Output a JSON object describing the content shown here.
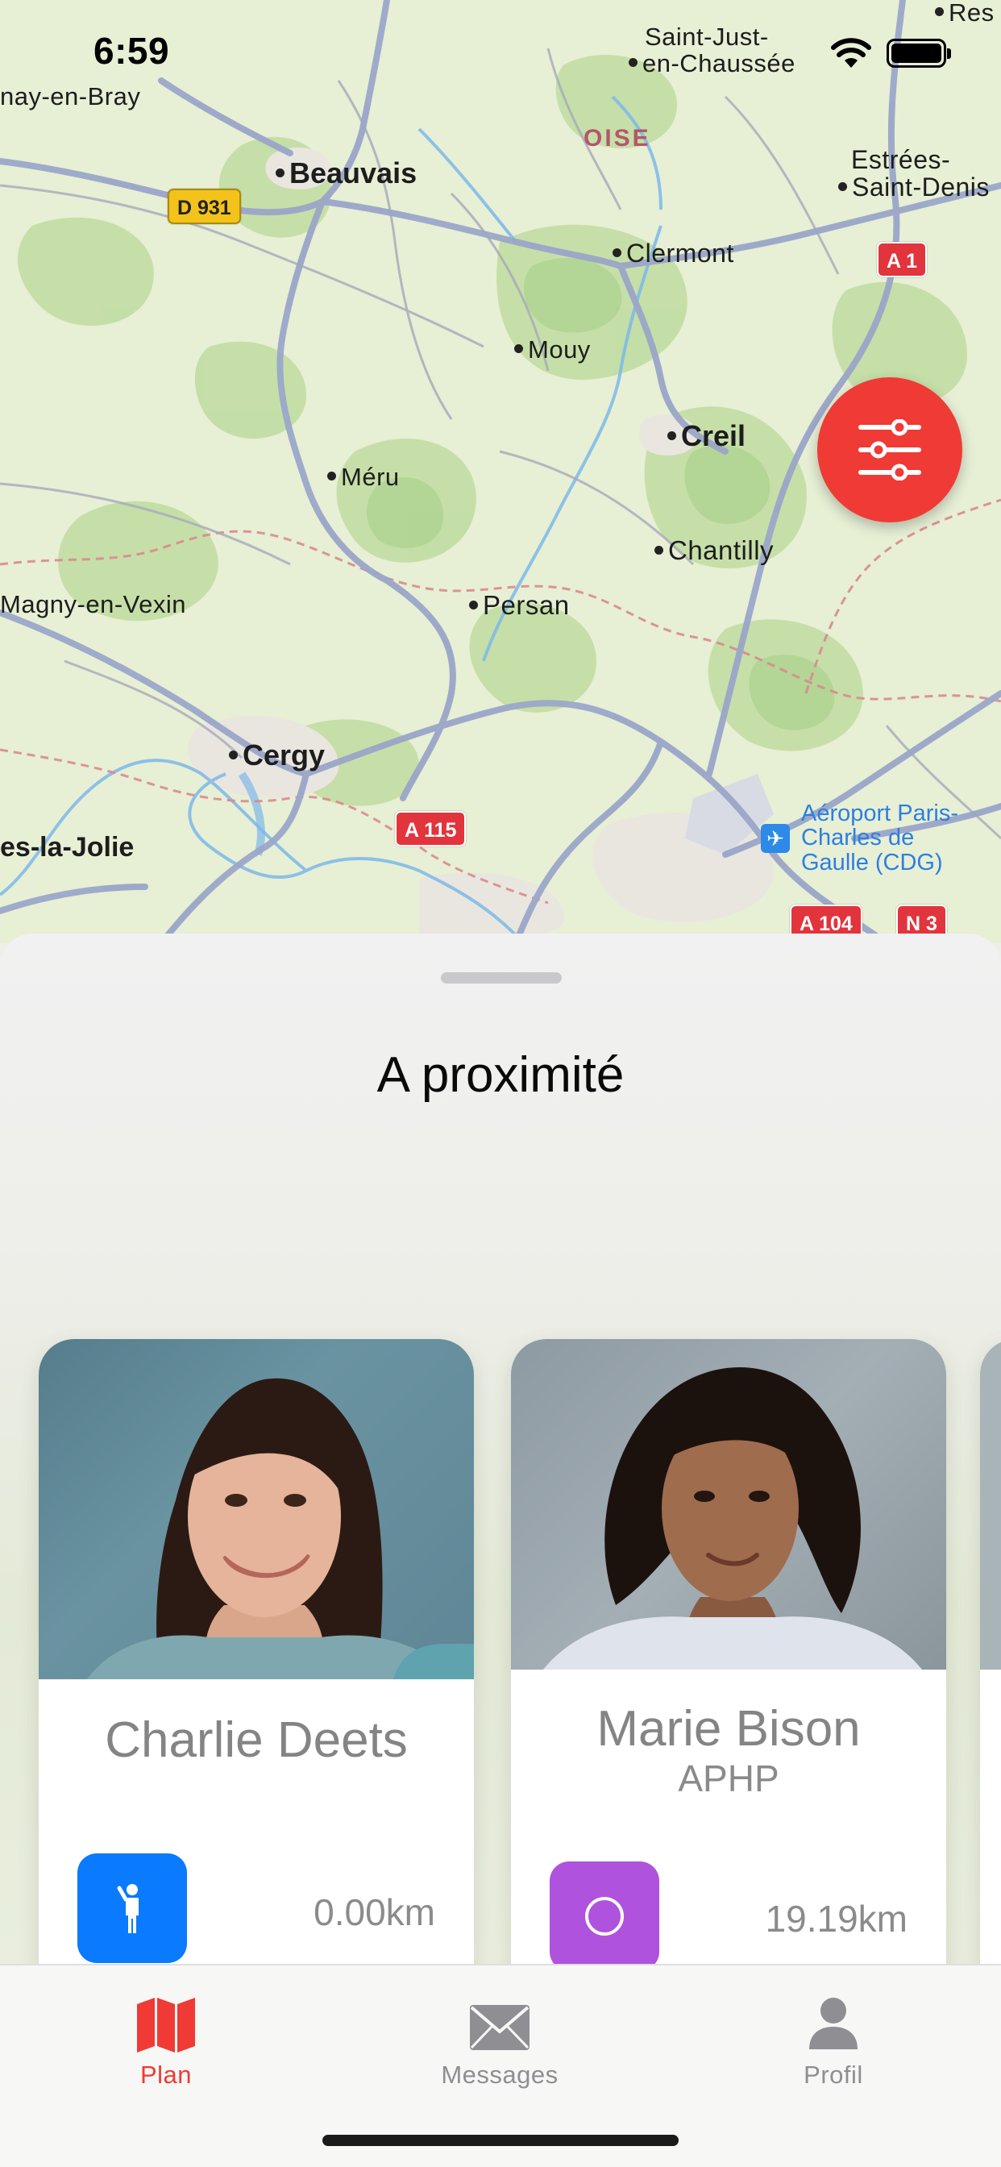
{
  "status_bar": {
    "time": "6:59"
  },
  "map": {
    "places": {
      "beauvais": "Beauvais",
      "clermont": "Clermont",
      "mouy": "Mouy",
      "creil": "Creil",
      "meru": "Méru",
      "chantilly": "Chantilly",
      "persan": "Persan",
      "magny": "Magny-en-Vexin",
      "cergy": "Cergy",
      "mantes": "es-la-Jolie",
      "saint_just_1": "Saint-Just-",
      "saint_just_2": "en-Chaussée",
      "estrees_1": "Estrées-",
      "estrees_2": "Saint-Denis",
      "bray": "nay-en-Bray",
      "ress": "Res",
      "oise": "OISE",
      "airport_1": "Aéroport Paris-",
      "airport_2": "Charles de",
      "airport_3": "Gaulle (CDG)"
    },
    "road_shields": {
      "d931": "D 931",
      "a1": "A 1",
      "a115": "A 115",
      "a104": "A 104",
      "n3": "N 3"
    }
  },
  "filter_button": {
    "icon": "sliders-icon"
  },
  "sheet": {
    "title": "A proximité",
    "cards": [
      {
        "name": "Charlie Deets",
        "organization": "",
        "distance": "0.00km",
        "badge_icon": "person-waving-icon",
        "badge_color": "#0a7aff"
      },
      {
        "name": "Marie Bison",
        "organization": "APHP",
        "distance": "19.19km",
        "badge_icon": "circle-icon",
        "badge_color": "#af52de"
      }
    ]
  },
  "tabs": [
    {
      "label": "Plan",
      "icon": "map-icon",
      "active": true
    },
    {
      "label": "Messages",
      "icon": "envelope-icon",
      "active": false
    },
    {
      "label": "Profil",
      "icon": "person-icon",
      "active": false
    }
  ],
  "colors": {
    "accent": "#f03a35",
    "inactive_tab": "#8e8e93"
  }
}
